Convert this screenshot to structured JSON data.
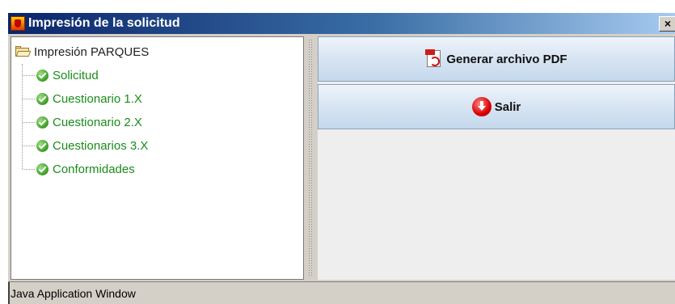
{
  "window": {
    "title": "Impresión de la solicitud",
    "close_label": "×"
  },
  "tree": {
    "root_label": "Impresión PARQUES",
    "children": [
      {
        "label": "Solicitud"
      },
      {
        "label": "Cuestionario 1.X"
      },
      {
        "label": "Cuestionario 2.X"
      },
      {
        "label": "Cuestionarios 3.X"
      },
      {
        "label": "Conformidades"
      }
    ]
  },
  "actions": {
    "generate_pdf_label": "Generar archivo PDF",
    "exit_label": "Salir"
  },
  "status": {
    "text": "Java Application Window"
  },
  "icons": {
    "app": "coat-of-arms-icon",
    "root": "open-folder-icon",
    "child": "green-check-icon",
    "pdf": "pdf-file-icon",
    "exit": "red-exit-icon"
  }
}
